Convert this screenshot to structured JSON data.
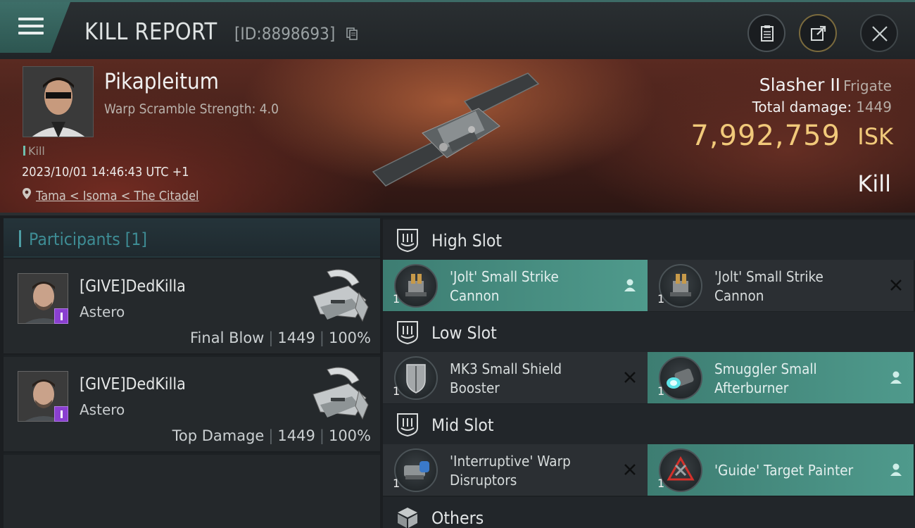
{
  "header": {
    "title": "KILL REPORT",
    "report_id": "[ID:8898693]"
  },
  "victim": {
    "name": "Pikapleitum",
    "subtitle": "Warp Scramble Strength: 4.0",
    "type_tag": "Kill",
    "timestamp": "2023/10/01 14:46:43 UTC +1",
    "location": "Tama < Isoma < The Citadel",
    "ship_name": "Slasher II",
    "ship_class": "Frigate",
    "total_damage_label": "Total damage:",
    "total_damage": "1449",
    "isk_value": "7,992,759",
    "isk_unit": "ISK",
    "result": "Kill"
  },
  "participants": {
    "label": "Participants [1]",
    "items": [
      {
        "name": "[GIVE]DedKilla",
        "ship": "Astero",
        "role": "Final Blow",
        "damage": "1449",
        "percent": "100%"
      },
      {
        "name": "[GIVE]DedKilla",
        "ship": "Astero",
        "role": "Top Damage",
        "damage": "1449",
        "percent": "100%"
      }
    ]
  },
  "slots": {
    "high": {
      "title": "High Slot",
      "modules": [
        {
          "name_line1": "'Jolt' Small Strike",
          "name_line2": "Cannon",
          "qty": "1",
          "status": "dropped"
        },
        {
          "name_line1": "'Jolt' Small Strike",
          "name_line2": "Cannon",
          "qty": "1",
          "status": "destroyed"
        }
      ]
    },
    "low": {
      "title": "Low Slot",
      "modules": [
        {
          "name_line1": "MK3 Small Shield",
          "name_line2": "Booster",
          "qty": "1",
          "status": "destroyed"
        },
        {
          "name_line1": "Smuggler Small",
          "name_line2": "Afterburner",
          "qty": "1",
          "status": "dropped"
        }
      ]
    },
    "mid": {
      "title": "Mid Slot",
      "modules": [
        {
          "name_line1": "'Interruptive' Warp",
          "name_line2": "Disruptors",
          "qty": "1",
          "status": "destroyed"
        },
        {
          "name_line1": "'Guide' Target Painter",
          "name_line2": "",
          "qty": "1",
          "status": "dropped"
        }
      ]
    },
    "others": {
      "title": "Others"
    }
  },
  "colors": {
    "accent_teal": "#4f9a8c",
    "isk_gold": "#f1c97a",
    "participants_teal": "#3e8d95",
    "badge_purple": "#8a3fd0"
  }
}
